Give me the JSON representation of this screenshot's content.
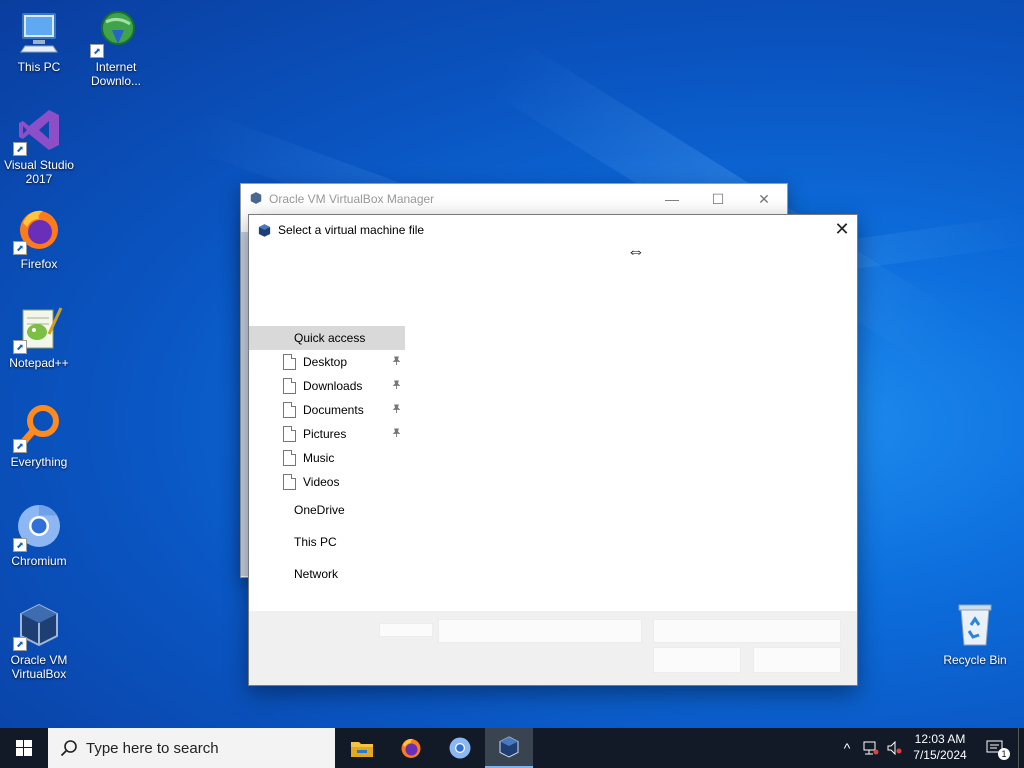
{
  "desktop": {
    "icons": [
      {
        "label": "This PC",
        "icon": "computer-icon"
      },
      {
        "label": "Internet Downlo...",
        "icon": "internet-download-manager-icon"
      },
      {
        "label": "Visual Studio 2017",
        "icon": "visual-studio-icon"
      },
      {
        "label": "Firefox",
        "icon": "firefox-icon"
      },
      {
        "label": "Notepad++",
        "icon": "notepad-plus-plus-icon"
      },
      {
        "label": "Everything",
        "icon": "everything-search-icon"
      },
      {
        "label": "Chromium",
        "icon": "chromium-icon"
      },
      {
        "label": "Oracle VM VirtualBox",
        "icon": "virtualbox-icon"
      },
      {
        "label": "Recycle Bin",
        "icon": "recycle-bin-icon"
      }
    ],
    "shortcut_glyph": "⬈"
  },
  "manager_window": {
    "title": "Oracle VM VirtualBox Manager",
    "minimize": "—",
    "maximize": "☐",
    "close": "✕"
  },
  "dialog": {
    "title": "Select a virtual machine file",
    "close": "✕",
    "cursor": "⇔",
    "nav": {
      "quick_access": "Quick access",
      "quick_items": [
        {
          "label": "Desktop",
          "pinned": true
        },
        {
          "label": "Downloads",
          "pinned": true
        },
        {
          "label": "Documents",
          "pinned": true
        },
        {
          "label": "Pictures",
          "pinned": true
        },
        {
          "label": "Music",
          "pinned": false
        },
        {
          "label": "Videos",
          "pinned": false
        }
      ],
      "locations": [
        "OneDrive",
        "This PC",
        "Network"
      ],
      "pin_glyph": "📌"
    }
  },
  "taskbar": {
    "search_placeholder": "Type here to search",
    "time": "12:03 AM",
    "date": "7/15/2024",
    "notification_count": "1",
    "tray_chevron": "^"
  }
}
